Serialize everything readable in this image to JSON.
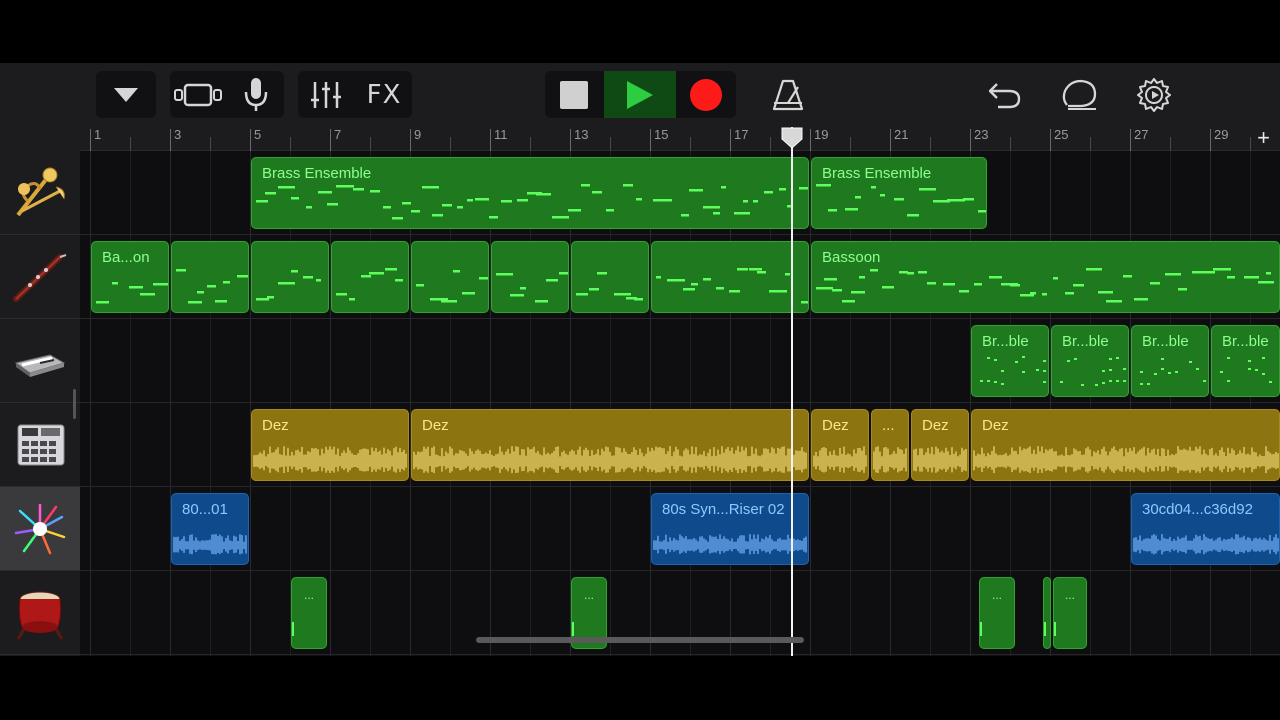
{
  "toolbar": {
    "fx_label": "FX",
    "buttons": [
      "my-songs-dropdown",
      "tracks-view",
      "microphone",
      "track-controls",
      "fx",
      "stop",
      "play",
      "record",
      "metronome",
      "undo",
      "loop-browser",
      "settings"
    ],
    "colors": {
      "play": "#2ecc40",
      "record": "#ff1a1a",
      "stop": "#d0d0d0",
      "icon": "#d6d6d6"
    }
  },
  "ruler": {
    "bar_labels": [
      "1",
      "3",
      "5",
      "7",
      "9",
      "11",
      "13",
      "15",
      "17",
      "19",
      "21",
      "23",
      "25",
      "27",
      "29"
    ],
    "add_label": "+",
    "playhead_bar": 18.5
  },
  "tracks": [
    {
      "instrument": "brass-ensemble-icon",
      "regions": [
        {
          "type": "midi",
          "label": "Brass Ensemble"
        },
        {
          "type": "midi",
          "label": "Brass Ensemble"
        }
      ]
    },
    {
      "instrument": "bassoon-icon",
      "regions": [
        {
          "type": "midi",
          "label": "Ba...on"
        },
        {
          "type": "midi",
          "label": ""
        },
        {
          "type": "midi",
          "label": ""
        },
        {
          "type": "midi",
          "label": ""
        },
        {
          "type": "midi",
          "label": ""
        },
        {
          "type": "midi",
          "label": ""
        },
        {
          "type": "midi",
          "label": ""
        },
        {
          "type": "midi",
          "label": ""
        },
        {
          "type": "midi",
          "label": "Bassoon"
        }
      ]
    },
    {
      "instrument": "keyboard-icon",
      "regions": [
        {
          "type": "midi",
          "label": "Br...ble"
        },
        {
          "type": "midi",
          "label": "Br...ble"
        },
        {
          "type": "midi",
          "label": "Br...ble"
        },
        {
          "type": "midi",
          "label": "Br...ble"
        }
      ]
    },
    {
      "instrument": "beat-sequencer-icon",
      "regions": [
        {
          "type": "audio-yellow",
          "label": "Dez"
        },
        {
          "type": "audio-yellow",
          "label": "Dez"
        },
        {
          "type": "audio-yellow",
          "label": "Dez"
        },
        {
          "type": "audio-yellow",
          "label": "..."
        },
        {
          "type": "audio-yellow",
          "label": "Dez"
        },
        {
          "type": "audio-yellow",
          "label": "Dez"
        }
      ]
    },
    {
      "instrument": "sampler-burst-icon",
      "selected": true,
      "regions": [
        {
          "type": "audio-blue",
          "label": "80...01"
        },
        {
          "type": "audio-blue",
          "label": "80s Syn...Riser 02"
        },
        {
          "type": "audio-blue",
          "label": "30cd04...c36d92"
        }
      ]
    },
    {
      "instrument": "taiko-drum-icon",
      "regions": [
        {
          "type": "midi",
          "label": "..."
        },
        {
          "type": "midi",
          "label": "..."
        },
        {
          "type": "midi",
          "label": "..."
        },
        {
          "type": "midi",
          "label": ""
        },
        {
          "type": "midi",
          "label": "..."
        }
      ]
    }
  ]
}
